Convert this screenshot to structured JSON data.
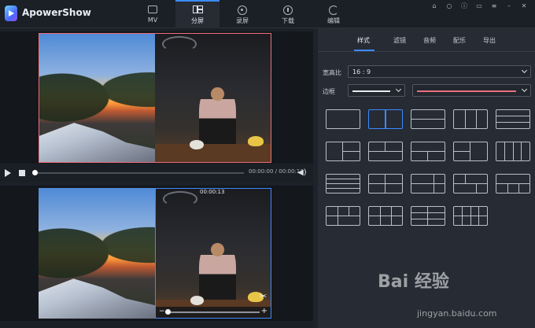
{
  "app": {
    "title": "ApowerShow"
  },
  "nav": {
    "tabs": [
      {
        "label": "MV",
        "icon": "tv-icon"
      },
      {
        "label": "分屏",
        "icon": "split-screen-icon",
        "active": true
      },
      {
        "label": "录屏",
        "icon": "record-icon"
      },
      {
        "label": "下载",
        "icon": "download-icon"
      },
      {
        "label": "编辑",
        "icon": "edit-icon"
      }
    ],
    "window_icons": [
      "cart-icon",
      "user-icon",
      "info-icon",
      "message-icon",
      "menu-icon",
      "minimize-icon",
      "close-icon"
    ]
  },
  "preview_top": {
    "time": "00:00:00 / 00:00:13",
    "progress": 0
  },
  "preview_bottom": {
    "overlay_time": "00:00:13"
  },
  "panel": {
    "tabs": [
      "样式",
      "滤镜",
      "音频",
      "配乐",
      "导出"
    ],
    "active_tab": "样式",
    "ratio_label": "宽高比",
    "ratio_value": "16 : 9",
    "border_label": "边框",
    "border_color": "#ea6f7c",
    "layouts_count": 24,
    "selected_layout": 2
  },
  "watermark": {
    "text": "Bai 经验",
    "url": "jingyan.baidu.com"
  },
  "colors": {
    "accent": "#3d8bff",
    "frame_top": "#ea6f7c",
    "frame_bottom": "#3d8bff"
  }
}
